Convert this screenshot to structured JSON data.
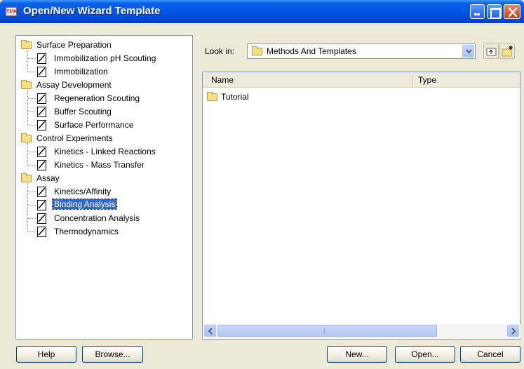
{
  "window": {
    "title": "Open/New Wizard Template",
    "app_icon_text": "T200",
    "title_color": "#0055e5"
  },
  "tree": {
    "groups": [
      {
        "label": "Surface Preparation",
        "items": [
          "Immobilization pH Scouting",
          "Immobilization"
        ]
      },
      {
        "label": "Assay Development",
        "items": [
          "Regeneration Scouting",
          "Buffer Scouting",
          "Surface Performance"
        ]
      },
      {
        "label": "Control Experiments",
        "items": [
          "Kinetics - Linked Reactions",
          "Kinetics - Mass Transfer"
        ]
      },
      {
        "label": "Assay",
        "items": [
          "Kinetics/Affinity",
          "Binding Analysis",
          "Concentration Analysis",
          "Thermodynamics"
        ]
      }
    ],
    "selected": "Binding Analysis",
    "selection_color": "#316ac5"
  },
  "browser": {
    "look_in_label": "Look in:",
    "look_in_value": "Methods And Templates",
    "columns": [
      "Name",
      "Type"
    ],
    "files": [
      {
        "name": "Tutorial",
        "icon": "folder-icon"
      }
    ]
  },
  "buttons": {
    "help": "Help",
    "browse": "Browse...",
    "new": "New...",
    "open": "Open...",
    "cancel": "Cancel"
  }
}
